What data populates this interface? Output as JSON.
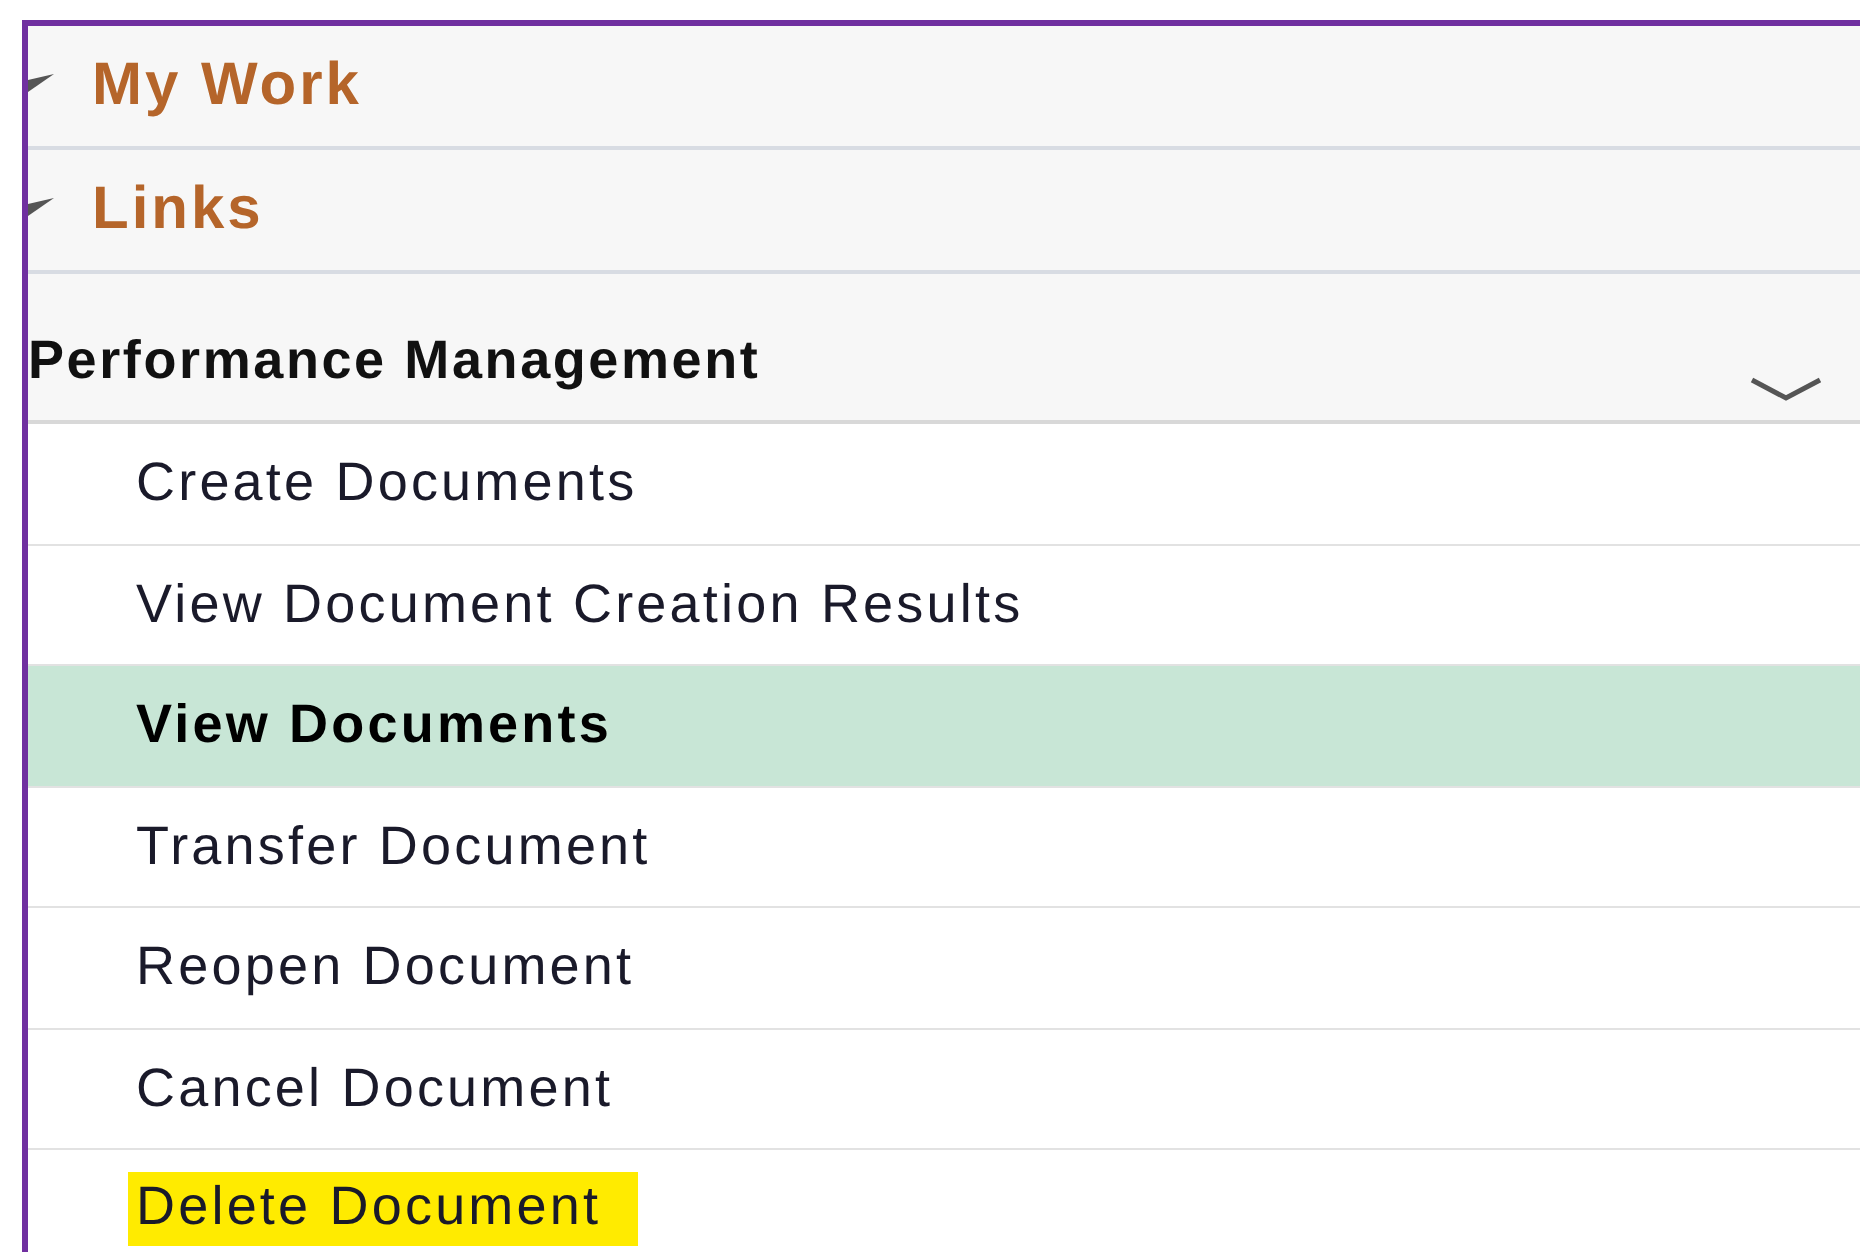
{
  "sections": [
    {
      "title": "My Work",
      "kind": "link-group",
      "expanded": false
    },
    {
      "title": "Links",
      "kind": "link-group",
      "expanded": false
    },
    {
      "title": "Performance Management",
      "kind": "menu",
      "expanded": true,
      "items": [
        {
          "label": "Create Documents",
          "selected": false,
          "highlighted": false
        },
        {
          "label": "View Document Creation Results",
          "selected": false,
          "highlighted": false
        },
        {
          "label": "View Documents",
          "selected": true,
          "highlighted": false
        },
        {
          "label": "Transfer Document",
          "selected": false,
          "highlighted": false
        },
        {
          "label": "Reopen Document",
          "selected": false,
          "highlighted": false
        },
        {
          "label": "Cancel Document",
          "selected": false,
          "highlighted": false
        },
        {
          "label": "Delete Document",
          "selected": false,
          "highlighted": true
        }
      ]
    }
  ]
}
